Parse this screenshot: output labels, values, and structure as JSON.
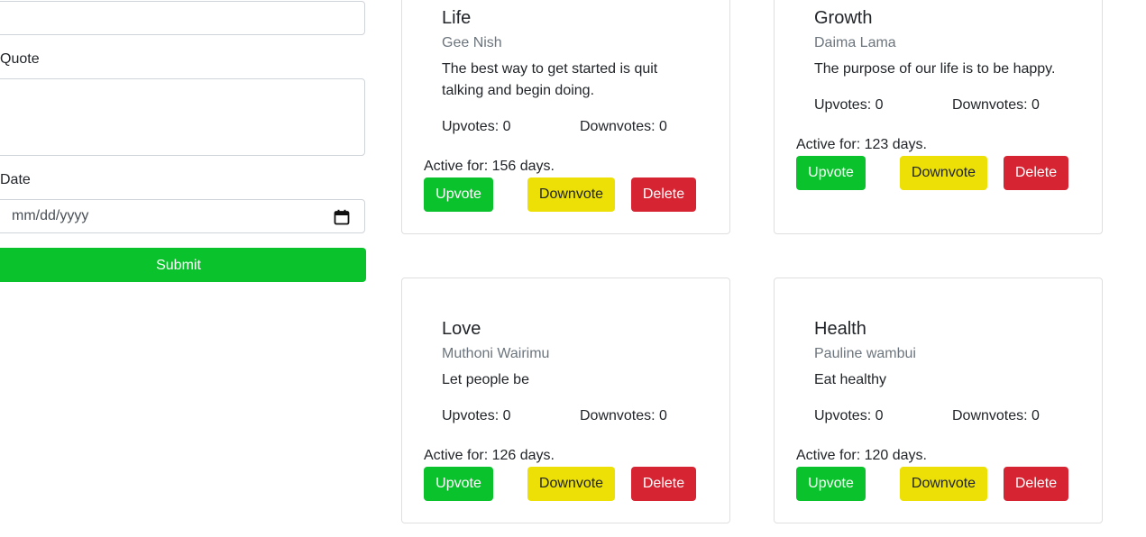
{
  "form": {
    "top_field_value": "",
    "quote_label": "Quote",
    "quote_value": "",
    "date_label": "Date",
    "date_placeholder": "mm/dd/yyyy",
    "submit_label": "Submit"
  },
  "colors": {
    "upvote": "#0ac22c",
    "downvote": "#ece007",
    "delete": "#d62433",
    "muted_text": "#6c757d"
  },
  "cards": [
    {
      "title": "Life",
      "author": "Gee Nish",
      "quote": "The best way to get started is quit talking and begin doing.",
      "upvotes": "Upvotes: 0",
      "downvotes": "Downvotes: 0",
      "active": "Active for: 156 days.",
      "upvote_label": "Upvote",
      "downvote_label": "Downvote",
      "delete_label": "Delete"
    },
    {
      "title": "Growth",
      "author": "Daima Lama",
      "quote": "The purpose of our life is to be happy.",
      "upvotes": "Upvotes: 0",
      "downvotes": "Downvotes: 0",
      "active": "Active for: 123 days.",
      "upvote_label": "Upvote",
      "downvote_label": "Downvote",
      "delete_label": "Delete"
    },
    {
      "title": "Love",
      "author": "Muthoni Wairimu",
      "quote": "Let people be",
      "upvotes": "Upvotes: 0",
      "downvotes": "Downvotes: 0",
      "active": "Active for: 126 days.",
      "upvote_label": "Upvote",
      "downvote_label": "Downvote",
      "delete_label": "Delete"
    },
    {
      "title": "Health",
      "author": "Pauline wambui",
      "quote": "Eat healthy",
      "upvotes": "Upvotes: 0",
      "downvotes": "Downvotes: 0",
      "active": "Active for: 120 days.",
      "upvote_label": "Upvote",
      "downvote_label": "Downvote",
      "delete_label": "Delete"
    }
  ]
}
